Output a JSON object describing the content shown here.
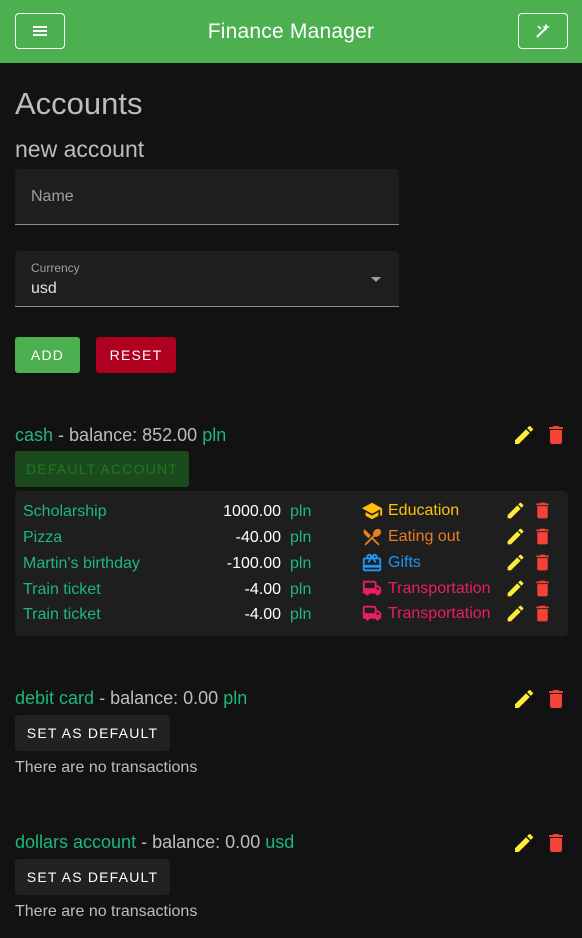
{
  "appbar": {
    "title": "Finance Manager",
    "menu_icon": "hamburger-menu-icon",
    "right_icon": "magic-wand-icon"
  },
  "page": {
    "title": "Accounts",
    "new_account_heading": "new account"
  },
  "form": {
    "name_placeholder": "Name",
    "currency_label": "Currency",
    "currency_value": "usd",
    "add_label": "ADD",
    "reset_label": "RESET"
  },
  "accounts": [
    {
      "name": "cash",
      "balance_label": "- balance:",
      "balance": "852.00",
      "currency": "pln",
      "default_label": "DEFAULT ACCOUNT",
      "transactions": [
        {
          "name": "Scholarship",
          "amount": "1000.00",
          "currency": "pln",
          "category": "Education",
          "category_color": "#ffc107",
          "category_icon": "graduation-cap-icon"
        },
        {
          "name": "Pizza",
          "amount": "-40.00",
          "currency": "pln",
          "category": "Eating out",
          "category_color": "#e67e22",
          "category_icon": "cutlery-icon"
        },
        {
          "name": "Martin's birthday",
          "amount": "-100.00",
          "currency": "pln",
          "category": "Gifts",
          "category_color": "#2196f3",
          "category_icon": "gift-icon"
        },
        {
          "name": "Train ticket",
          "amount": "-4.00",
          "currency": "pln",
          "category": "Transportation",
          "category_color": "#e91e63",
          "category_icon": "bus-icon"
        },
        {
          "name": "Train ticket",
          "amount": "-4.00",
          "currency": "pln",
          "category": "Transportation",
          "category_color": "#e91e63",
          "category_icon": "bus-icon"
        }
      ]
    },
    {
      "name": "debit card",
      "balance_label": "- balance:",
      "balance": "0.00",
      "currency": "pln",
      "set_default_label": "SET AS DEFAULT",
      "empty_text": "There are no transactions"
    },
    {
      "name": "dollars account",
      "balance_label": "- balance:",
      "balance": "0.00",
      "currency": "usd",
      "set_default_label": "SET AS DEFAULT",
      "empty_text": "There are no transactions"
    }
  ],
  "colors": {
    "primary": "#4caf50",
    "reset": "#b00020",
    "accent_green": "#1db87a",
    "edit": "#ffeb3b",
    "delete": "#f44336"
  }
}
